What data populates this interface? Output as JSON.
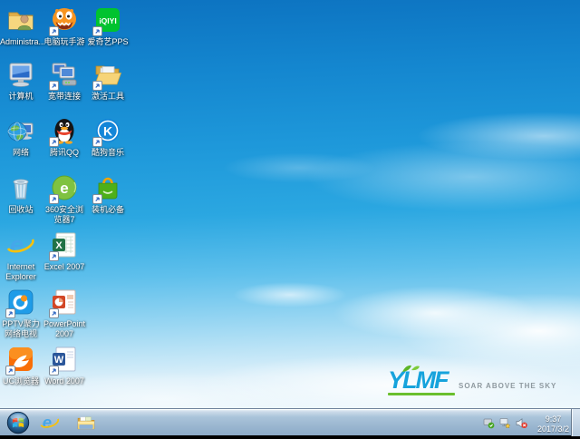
{
  "colors": {
    "sky_top": "#0c72c0",
    "sky_bottom": "#eef8fd",
    "taskbar": "#9ab6d0",
    "icon_label_text": "#ffffff",
    "watermark_blue": "#16a3dc",
    "watermark_green": "#6abf2e",
    "watermark_gray": "#8e999f"
  },
  "desktop": {
    "icons": [
      {
        "name": "administrator-folder",
        "label": "Administra...",
        "shortcut": false
      },
      {
        "name": "pc-play-mobile-games",
        "label": "电脑玩手游",
        "shortcut": true
      },
      {
        "name": "iqiyi-pps",
        "label": "爱奇艺PPS",
        "shortcut": true,
        "glyph": "iQIYI"
      },
      {
        "name": "computer",
        "label": "计算机",
        "shortcut": false
      },
      {
        "name": "broadband-connection",
        "label": "宽带连接",
        "shortcut": true
      },
      {
        "name": "activation-tools",
        "label": "激活工具",
        "shortcut": true
      },
      {
        "name": "network",
        "label": "网络",
        "shortcut": false
      },
      {
        "name": "tencent-qq",
        "label": "腾讯QQ",
        "shortcut": true
      },
      {
        "name": "kugou-music",
        "label": "酷狗音乐",
        "shortcut": true,
        "glyph": "K"
      },
      {
        "name": "recycle-bin",
        "label": "回收站",
        "shortcut": false
      },
      {
        "name": "360-secure-browser-7",
        "label": "360安全浏览器7",
        "shortcut": true,
        "glyph": "e"
      },
      {
        "name": "essential-apps-bag",
        "label": "装机必备",
        "shortcut": true
      },
      {
        "name": "internet-explorer",
        "label": "Internet Explorer",
        "shortcut": false,
        "glyph": "e"
      },
      {
        "name": "excel-2007",
        "label": "Excel 2007",
        "shortcut": true,
        "glyph": "X"
      },
      {
        "name": "pptv-netvideo",
        "label": "PPTV聚力 网络电视",
        "shortcut": true
      },
      {
        "name": "powerpoint-2007",
        "label": "PowerPoint 2007",
        "shortcut": true
      },
      {
        "name": "uc-browser",
        "label": "UC浏览器",
        "shortcut": true
      },
      {
        "name": "word-2007",
        "label": "Word 2007",
        "shortcut": true,
        "glyph": "W"
      }
    ],
    "watermark": {
      "logo": "YLMF",
      "tagline": "SOAR ABOVE THE SKY"
    }
  },
  "taskbar": {
    "pinned": [
      "start-button",
      "internet-explorer",
      "windows-explorer"
    ],
    "tray": {
      "icons": [
        "update-ready-icon",
        "network-warning-icon",
        "volume-muted-icon"
      ],
      "time": "9:37",
      "date": "2017/3/2"
    }
  }
}
